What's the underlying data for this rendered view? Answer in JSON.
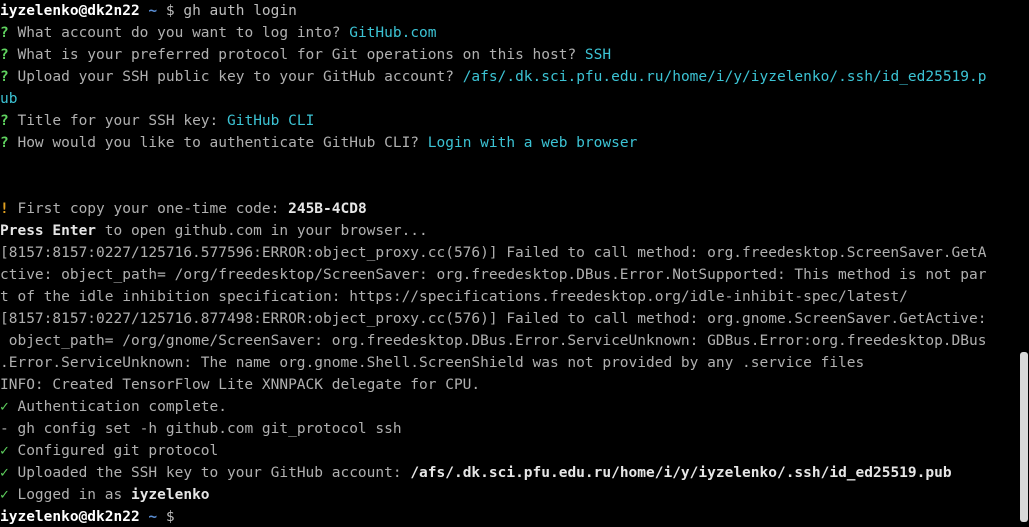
{
  "prompt": {
    "user_host": "iyzelenko@dk2n22",
    "path": "~",
    "symbol": "$"
  },
  "first_command": "gh auth login",
  "questions": [
    {
      "mark": "?",
      "text": "What account do you want to log into?",
      "answer": "GitHub.com"
    },
    {
      "mark": "?",
      "text": "What is your preferred protocol for Git operations on this host?",
      "answer": "SSH"
    },
    {
      "mark": "?",
      "text": "Upload your SSH public key to your GitHub account?",
      "answer": "/afs/.dk.sci.pfu.edu.ru/home/i/y/iyzelenko/.ssh/id_ed25519.p",
      "answer_wrap": "ub"
    },
    {
      "mark": "?",
      "text": "Title for your SSH key:",
      "answer": "GitHub CLI"
    },
    {
      "mark": "?",
      "text": "How would you like to authenticate GitHub CLI?",
      "answer": "Login with a web browser"
    }
  ],
  "one_time": {
    "mark": "!",
    "text": "First copy your one-time code:",
    "code": "245B-4CD8"
  },
  "press_enter": {
    "bold": "Press Enter",
    "rest": "to open github.com in your browser..."
  },
  "log_lines": [
    "[8157:8157:0227/125716.577596:ERROR:object_proxy.cc(576)] Failed to call method: org.freedesktop.ScreenSaver.GetA",
    "ctive: object_path= /org/freedesktop/ScreenSaver: org.freedesktop.DBus.Error.NotSupported: This method is not par",
    "t of the idle inhibition specification: https://specifications.freedesktop.org/idle-inhibit-spec/latest/",
    "[8157:8157:0227/125716.877498:ERROR:object_proxy.cc(576)] Failed to call method: org.gnome.ScreenSaver.GetActive:",
    " object_path= /org/gnome/ScreenSaver: org.freedesktop.DBus.Error.ServiceUnknown: GDBus.Error:org.freedesktop.DBus",
    ".Error.ServiceUnknown: The name org.gnome.Shell.ScreenShield was not provided by any .service files",
    "INFO: Created TensorFlow Lite XNNPACK delegate for CPU."
  ],
  "status": {
    "check": "✓",
    "dash": "-",
    "auth_complete": "Authentication complete.",
    "config_cmd": "gh config set -h github.com git_protocol ssh",
    "configured": "Configured git protocol",
    "uploaded_prefix": "Uploaded the SSH key to your GitHub account:",
    "uploaded_path": "/afs/.dk.sci.pfu.edu.ru/home/i/y/iyzelenko/.ssh/id_ed25519.pub",
    "logged_prefix": "Logged in as",
    "logged_user": "iyzelenko"
  },
  "colors": {
    "background": "#000000",
    "answer": "#3cc3d4",
    "question_mark": "#5fd35f",
    "warning": "#e0a020",
    "path": "#5b8fd6"
  },
  "icons": {
    "scrollbar": "scrollbar-thumb"
  }
}
